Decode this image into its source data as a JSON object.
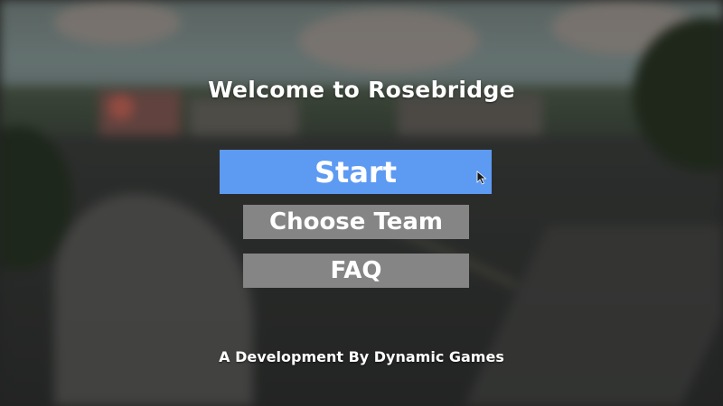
{
  "menu": {
    "title": "Welcome to Rosebridge",
    "buttons": {
      "start": "Start",
      "choose_team": "Choose Team",
      "faq": "FAQ"
    },
    "footer": "A Development By Dynamic Games"
  },
  "colors": {
    "start_button": "#5d9af2",
    "secondary_button": "#858585",
    "text": "#ffffff"
  },
  "icons": {
    "cursor": "mouse-pointer-icon"
  }
}
